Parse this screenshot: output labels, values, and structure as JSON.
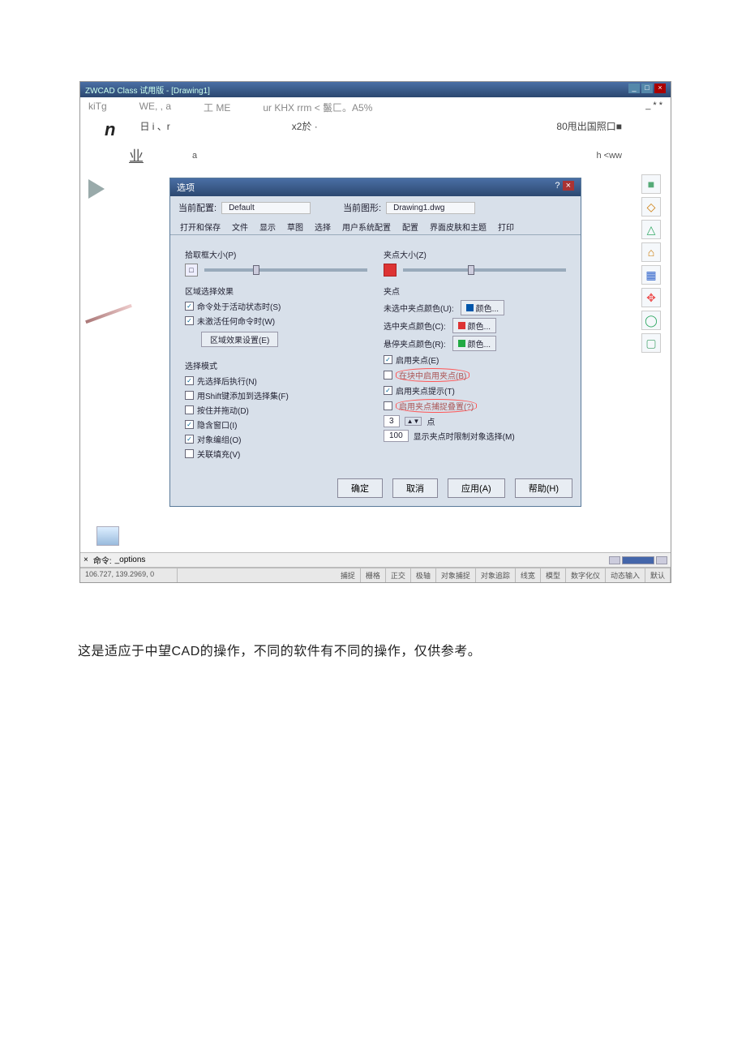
{
  "titlebar": {
    "text": "ZWCAD Class 试用版 - [Drawing1]"
  },
  "menubar": {
    "items": [
      "kiTg",
      "WE, , a",
      "工 ME",
      "ur KHX rrm < 鬣匚。A5%"
    ],
    "suffix": "_ * *",
    "row2_left": "日 i 、r",
    "row2_center": "x2於 ·",
    "row2_right": "80甩出国照口■",
    "prefix_big": "n"
  },
  "decor": {
    "sym": "业",
    "a": "a",
    "hww": "h <ww"
  },
  "sidebar_right": [
    "■",
    "◇",
    "△",
    "⌂",
    "▦",
    "✥",
    "◯",
    "▢"
  ],
  "dialog": {
    "title": "选项",
    "q": "?",
    "top": {
      "config_label": "当前配置:",
      "config_value": "Default",
      "draw_label": "当前图形:",
      "draw_value": "Drawing1.dwg"
    },
    "tabs": [
      "打开和保存",
      "文件",
      "显示",
      "草图",
      "选择",
      "用户系统配置",
      "配置",
      "界面皮肤和主题",
      "打印"
    ],
    "left": {
      "pickbox_label": "拾取框大小(P)",
      "effect_title": "区域选择效果",
      "chk1": "命令处于活动状态时(S)",
      "chk2": "未激活任何命令时(W)",
      "effect_btn": "区域效果设置(E)",
      "mode_title": "选择模式",
      "m1": "先选择后执行(N)",
      "m2": "用Shift键添加到选择集(F)",
      "m3": "按住并拖动(D)",
      "m4": "隐含窗口(I)",
      "m5": "对象编组(O)",
      "m6": "关联填充(V)"
    },
    "right": {
      "grip_label": "夹点大小(Z)",
      "grip_title": "夹点",
      "c1_label": "未选中夹点颜色(U):",
      "c1_btn": "颜色...",
      "c2_label": "选中夹点颜色(C):",
      "c2_btn": "颜色...",
      "c3_label": "悬停夹点颜色(R):",
      "c3_btn": "颜色...",
      "g1": "启用夹点(E)",
      "g2": "在块中启用夹点(B)",
      "g3": "启用夹点提示(T)",
      "g4": "启用夹点捕捉叠置(?)",
      "spin_val": "3",
      "spin_suffix": "点",
      "limit_val": "100",
      "limit_label": "显示夹点时限制对象选择(M)"
    },
    "buttons": {
      "ok": "确定",
      "cancel": "取消",
      "apply": "应用(A)",
      "help": "帮助(H)"
    }
  },
  "cmdline": {
    "prefix": "命令:",
    "cmd": "_options"
  },
  "status": {
    "coord": "106.727, 139.2969, 0",
    "cells": [
      "捕捉",
      "栅格",
      "正交",
      "极轴",
      "对象捕捉",
      "对象追踪",
      "线宽",
      "模型",
      "数字化仪",
      "动态输入",
      "默认"
    ]
  },
  "caption": "这是适应于中望CAD的操作，不同的软件有不同的操作，仅供参考。"
}
